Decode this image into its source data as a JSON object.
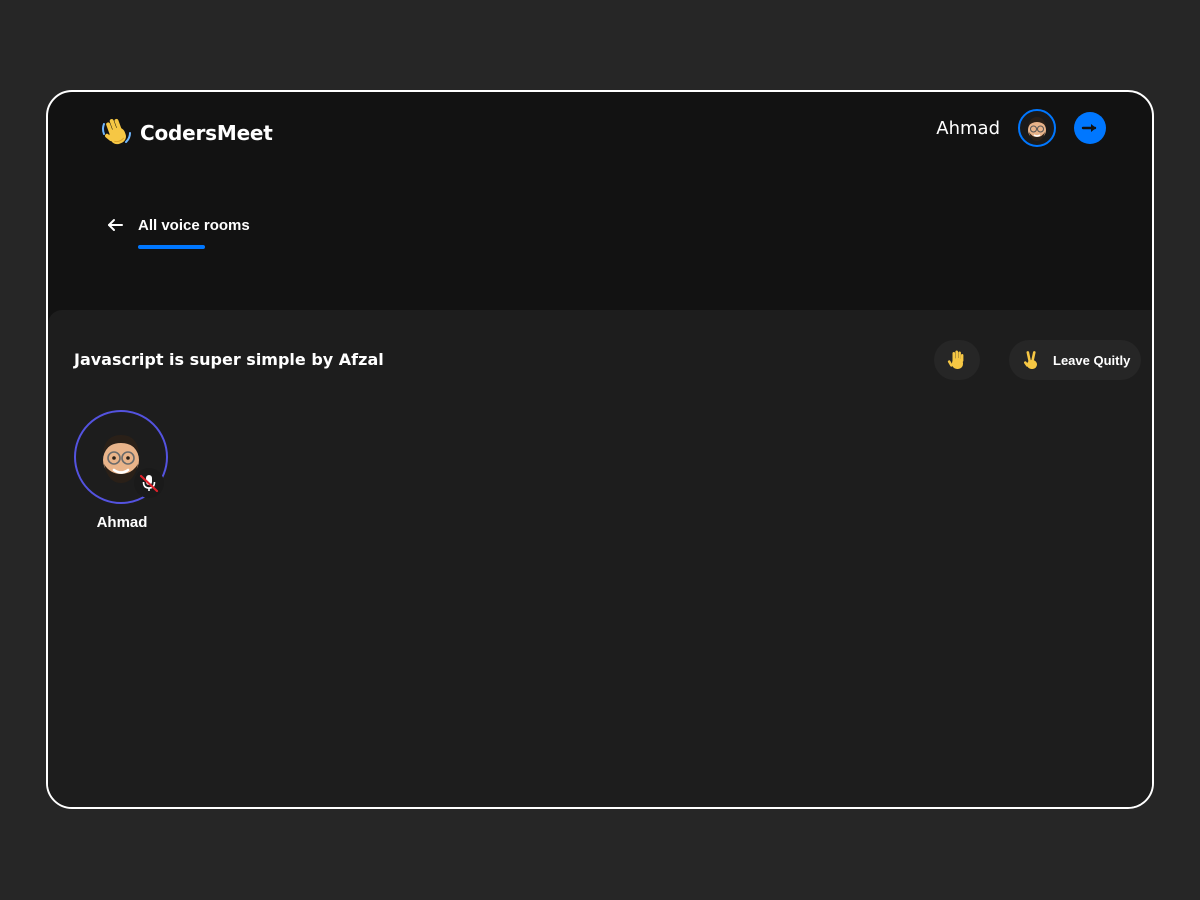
{
  "app": {
    "brand_name": "CodersMeet",
    "brand_icon": "waving-hand-icon",
    "accent_color": "#0077ff"
  },
  "header": {
    "user_name": "Ahmad",
    "avatar_icon": "user-avatar-memoji",
    "logout_icon": "arrow-right-icon"
  },
  "nav": {
    "back_label": "All voice rooms"
  },
  "room": {
    "title": "Javascript is super simple by Afzal",
    "raise_hand_icon": "raised-hand-icon",
    "leave_label": "Leave Quitly",
    "leave_icon": "victory-hand-icon",
    "speakers": [
      {
        "name": "Ahmad",
        "muted": true,
        "ring_color": "#5453e0"
      }
    ]
  }
}
